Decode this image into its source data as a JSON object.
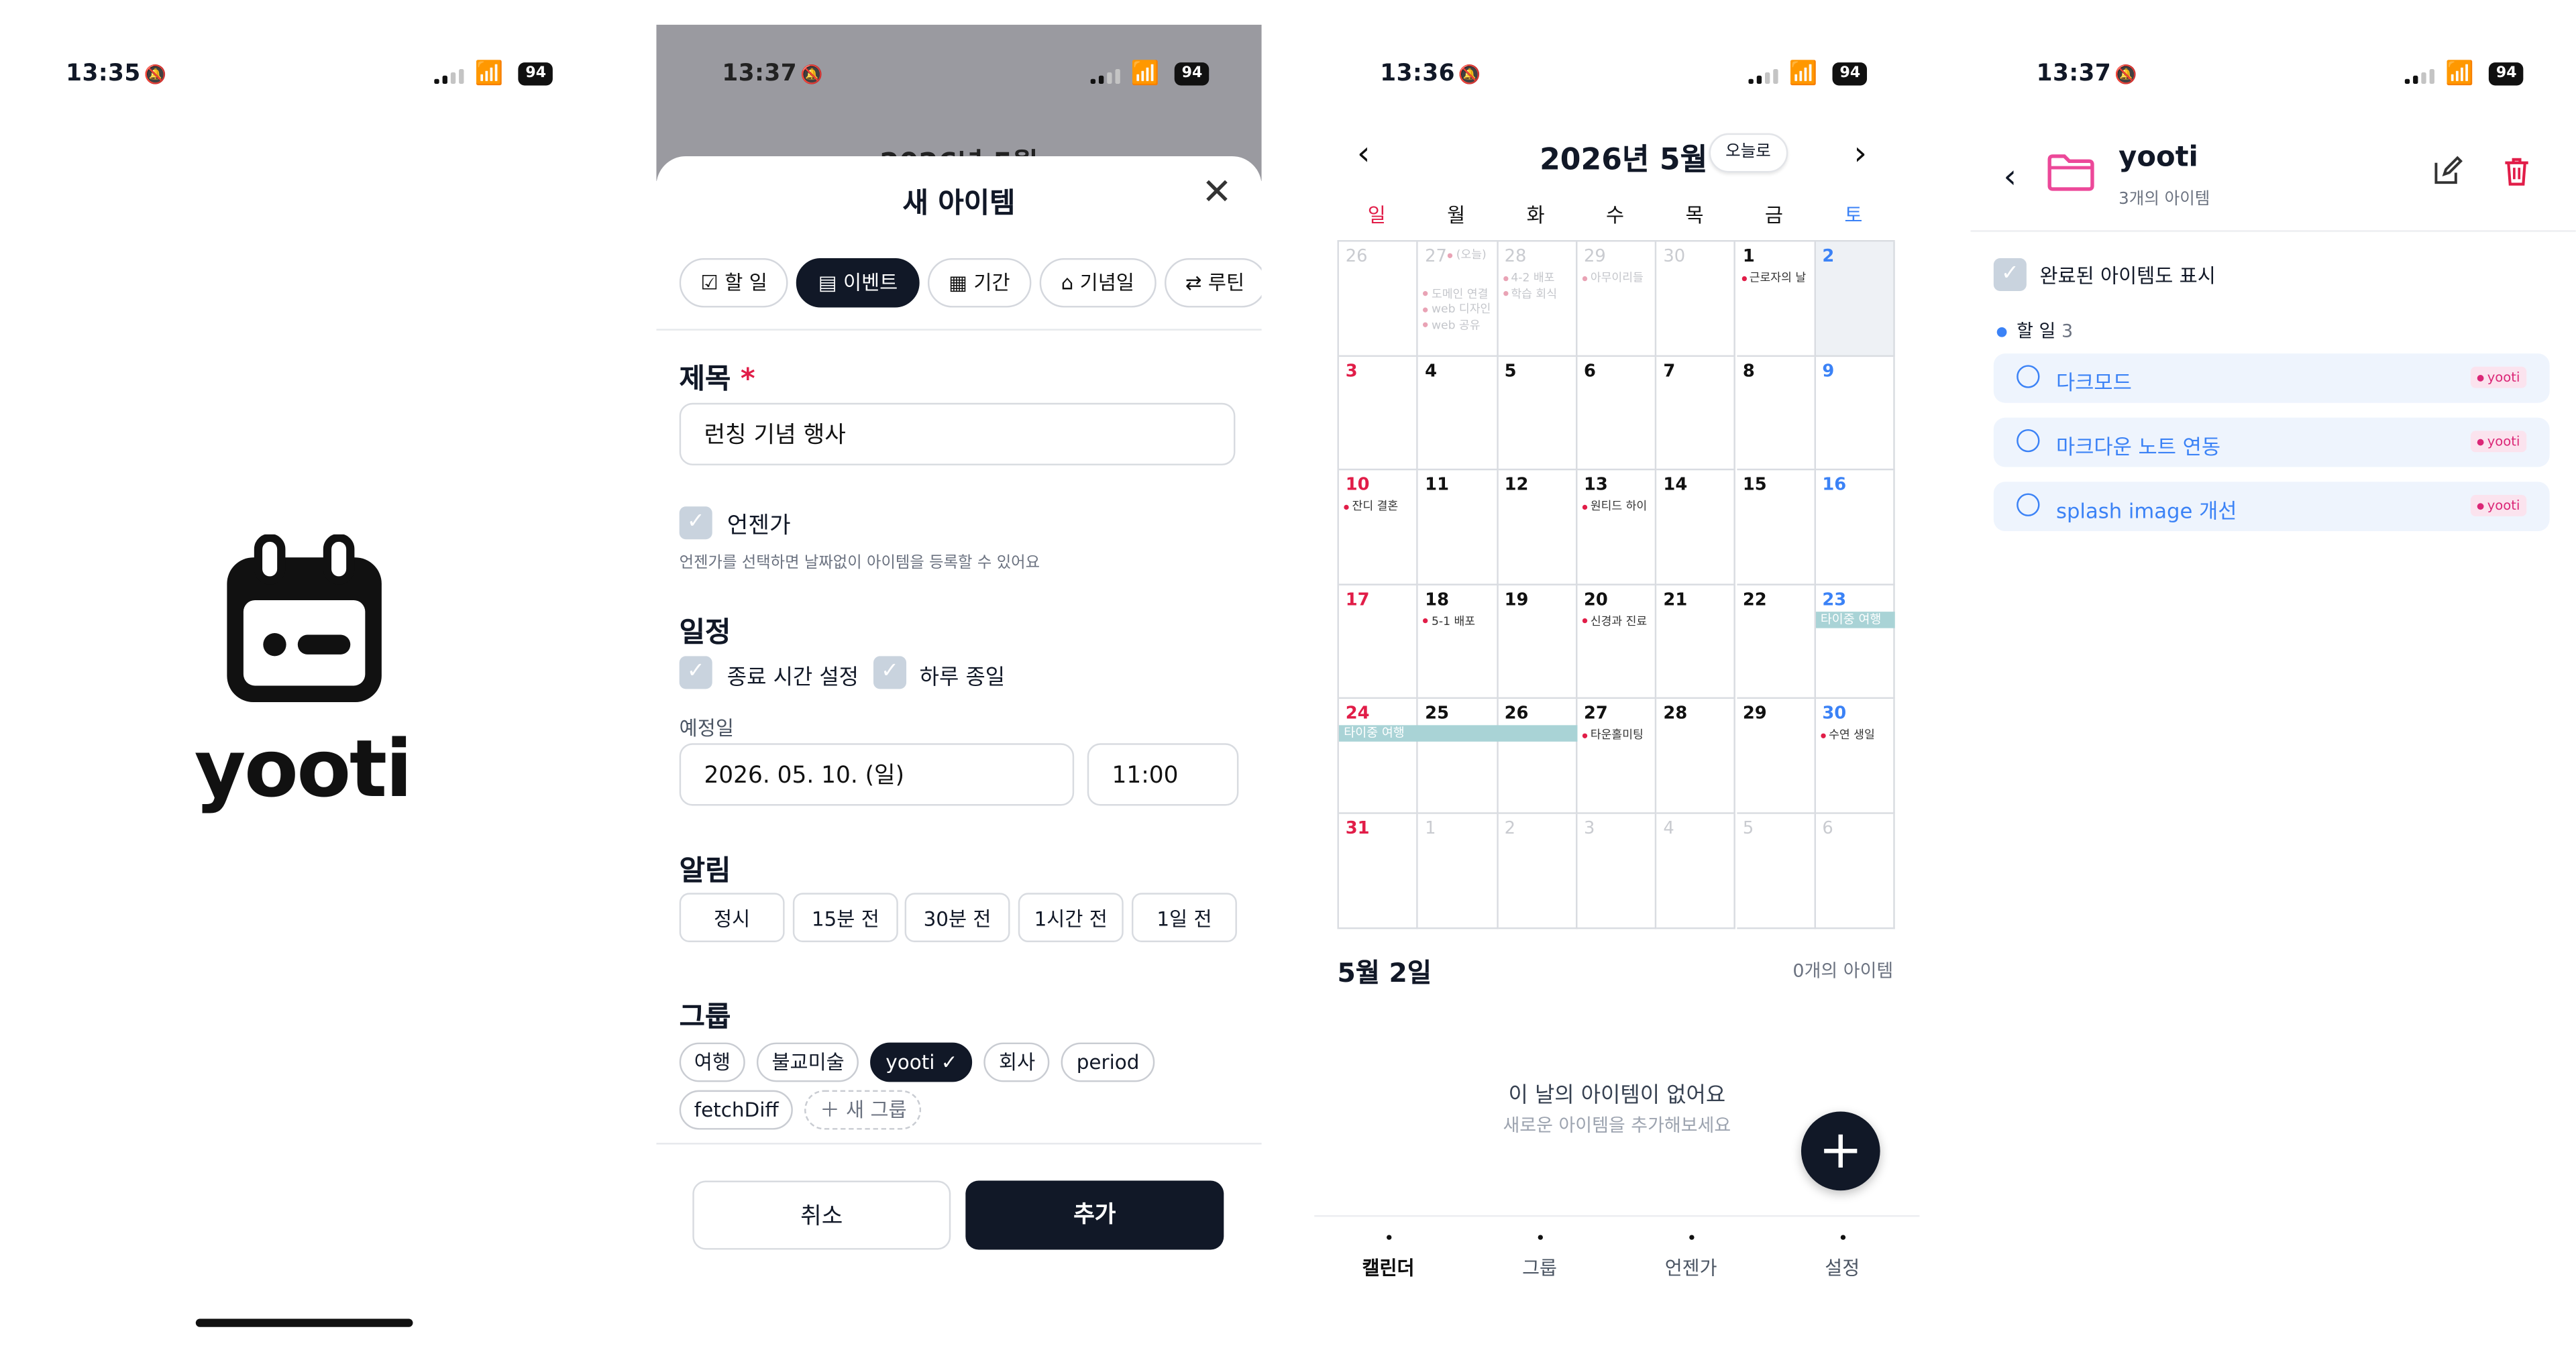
{
  "screens": {
    "splash": {
      "time": "13:35",
      "battery": "94",
      "logo_text": "yooti"
    },
    "new_item": {
      "time": "13:37",
      "battery": "94",
      "behind_header": "2026년 5월",
      "behind_today": "오늘로",
      "title": "새 아이템",
      "types": [
        "할 일",
        "이벤트",
        "기간",
        "기념일",
        "루틴"
      ],
      "title_label": "제목",
      "required_mark": "*",
      "title_value": "런칭 기념 행사",
      "someday_label": "언젠가",
      "someday_hint": "언젠가를 선택하면 날짜없이 아이템을 등록할 수 있어요",
      "schedule_label": "일정",
      "end_time_label": "종료 시간 설정",
      "all_day_label": "하루 종일",
      "date_label": "예정일",
      "date_value": "2026. 05. 10. (일)",
      "time_value": "11:00",
      "alarm_label": "알림",
      "alarms": [
        "정시",
        "15분 전",
        "30분 전",
        "1시간 전",
        "1일 전"
      ],
      "group_label": "그룹",
      "groups": [
        "여행",
        "불교미술",
        "yooti",
        "회사",
        "period",
        "fetchDiff"
      ],
      "new_group": "새 그룹",
      "cancel": "취소",
      "add": "추가"
    },
    "calendar": {
      "time": "13:36",
      "battery": "94",
      "month_title": "2026년 5월",
      "today_button": "오늘로",
      "weekdays": [
        "일",
        "월",
        "화",
        "수",
        "목",
        "금",
        "토"
      ],
      "weeks": [
        [
          {
            "d": "26",
            "out": true
          },
          {
            "d": "27",
            "out": true,
            "ev": [
              "(오늘)",
              "도메인 연결",
              "web 디자인",
              "web 공유"
            ]
          },
          {
            "d": "28",
            "out": true,
            "ev": [
              "4-2 배포",
              "학습 회식"
            ]
          },
          {
            "d": "29",
            "out": true,
            "ev": [
              "아무이리들"
            ]
          },
          {
            "d": "30",
            "out": true
          },
          {
            "d": "1",
            "ev": [
              "근로자의 날"
            ]
          },
          {
            "d": "2"
          }
        ],
        [
          {
            "d": "3"
          },
          {
            "d": "4"
          },
          {
            "d": "5"
          },
          {
            "d": "6"
          },
          {
            "d": "7"
          },
          {
            "d": "8"
          },
          {
            "d": "9"
          }
        ],
        [
          {
            "d": "10",
            "ev": [
              "잔디 결혼"
            ]
          },
          {
            "d": "11"
          },
          {
            "d": "12"
          },
          {
            "d": "13",
            "ev": [
              "원티드 하이"
            ]
          },
          {
            "d": "14"
          },
          {
            "d": "15"
          },
          {
            "d": "16"
          }
        ],
        [
          {
            "d": "17"
          },
          {
            "d": "18",
            "ev": [
              "5-1 배포"
            ]
          },
          {
            "d": "19"
          },
          {
            "d": "20",
            "ev": [
              "신경과 진료"
            ]
          },
          {
            "d": "21"
          },
          {
            "d": "22"
          },
          {
            "d": "23"
          }
        ],
        [
          {
            "d": "24"
          },
          {
            "d": "25"
          },
          {
            "d": "26"
          },
          {
            "d": "27",
            "ev": [
              "타운홀미팅"
            ]
          },
          {
            "d": "28"
          },
          {
            "d": "29"
          },
          {
            "d": "30",
            "ev": [
              "수연 생일"
            ]
          }
        ],
        [
          {
            "d": "31"
          },
          {
            "d": "1",
            "out": true
          },
          {
            "d": "2",
            "out": true
          },
          {
            "d": "3",
            "out": true
          },
          {
            "d": "4",
            "out": true
          },
          {
            "d": "5",
            "out": true
          },
          {
            "d": "6",
            "out": true
          }
        ]
      ],
      "trip_label": "타이중 여행",
      "selected_day": "5월 2일",
      "item_count": "0개의 아이템",
      "empty_title": "이 날의 아이템이 없어요",
      "empty_sub": "새로운 아이템을 추가해보세요",
      "tabs": [
        "캘린더",
        "그룹",
        "언젠가",
        "설정"
      ]
    },
    "group": {
      "time": "13:37",
      "battery": "94",
      "name": "yooti",
      "count": "3개의 아이템",
      "show_completed": "완료된 아이템도 표시",
      "section": "할 일",
      "section_count": "3",
      "todos": [
        "다크모드",
        "마크다운 노트 연동",
        "splash image 개선"
      ],
      "tag": "yooti"
    }
  },
  "colors": {
    "primary": "#111827",
    "accent_blue": "#3b82f6",
    "sunday_red": "#e11d48",
    "trip_teal": "#a9d3d6",
    "folder_pink": "#ec4899"
  }
}
